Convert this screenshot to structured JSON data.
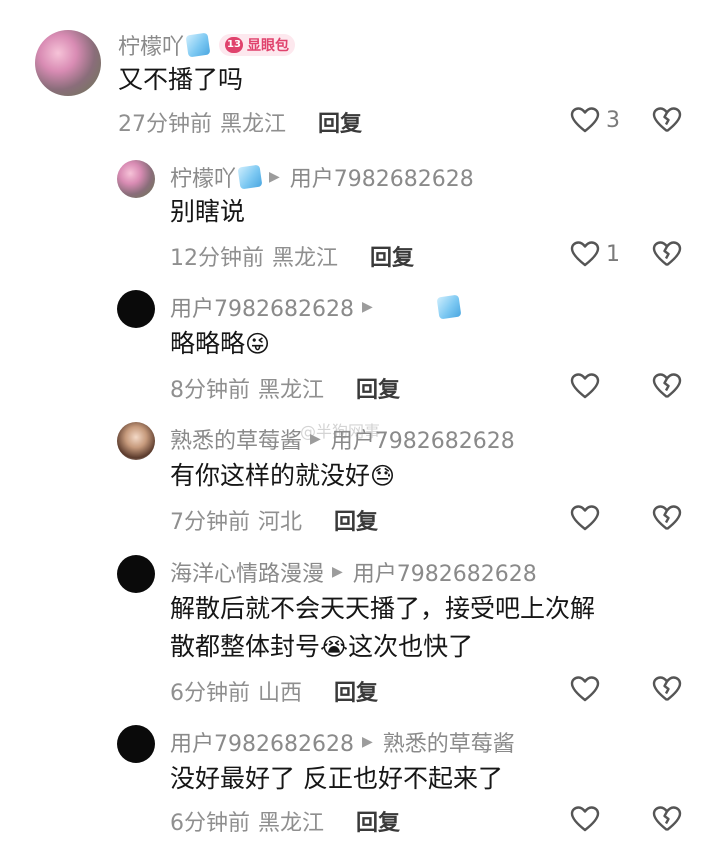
{
  "comments": [
    {
      "user": "柠檬吖",
      "badge_level": "13",
      "badge_label": "显眼包",
      "text": "又不播了吗",
      "time": "27分钟前",
      "location": "黑龙江",
      "reply_label": "回复",
      "likes": "3"
    },
    {
      "user": "柠檬吖",
      "reply_to": "用户7982682628",
      "text": "别瞎说",
      "time": "12分钟前",
      "location": "黑龙江",
      "reply_label": "回复",
      "likes": "1"
    },
    {
      "user": "用户7982682628",
      "reply_to": "",
      "text": "略略略",
      "emoji": "😜",
      "time": "8分钟前",
      "location": "黑龙江",
      "reply_label": "回复"
    },
    {
      "user": "熟悉的草莓酱",
      "reply_to": "用户7982682628",
      "text": "有你这样的就没好",
      "emoji": "😓",
      "time": "7分钟前",
      "location": "河北",
      "reply_label": "回复"
    },
    {
      "user": "海洋心情路漫漫",
      "reply_to": "用户7982682628",
      "text_line1": "解散后就不会天天播了，接受吧上次解",
      "text_line2": "散都整体封号",
      "emoji": "😭",
      "text_line2_end": "这次也快了",
      "time": "6分钟前",
      "location": "山西",
      "reply_label": "回复"
    },
    {
      "user": "用户7982682628",
      "reply_to": "熟悉的草莓酱",
      "text": "没好最好了 反正也好不起来了",
      "time": "6分钟前",
      "location": "黑龙江",
      "reply_label": "回复"
    }
  ],
  "watermark": "@半狗网事",
  "icons": {
    "like": "heart-outline-icon",
    "dislike": "broken-heart-icon",
    "reply_arrow": "play-arrow-icon",
    "ice": "ice-cube-icon"
  },
  "colors": {
    "badge_bg": "#fde8ee",
    "badge_fg": "#e0436d",
    "meta": "#8f8f8f"
  }
}
